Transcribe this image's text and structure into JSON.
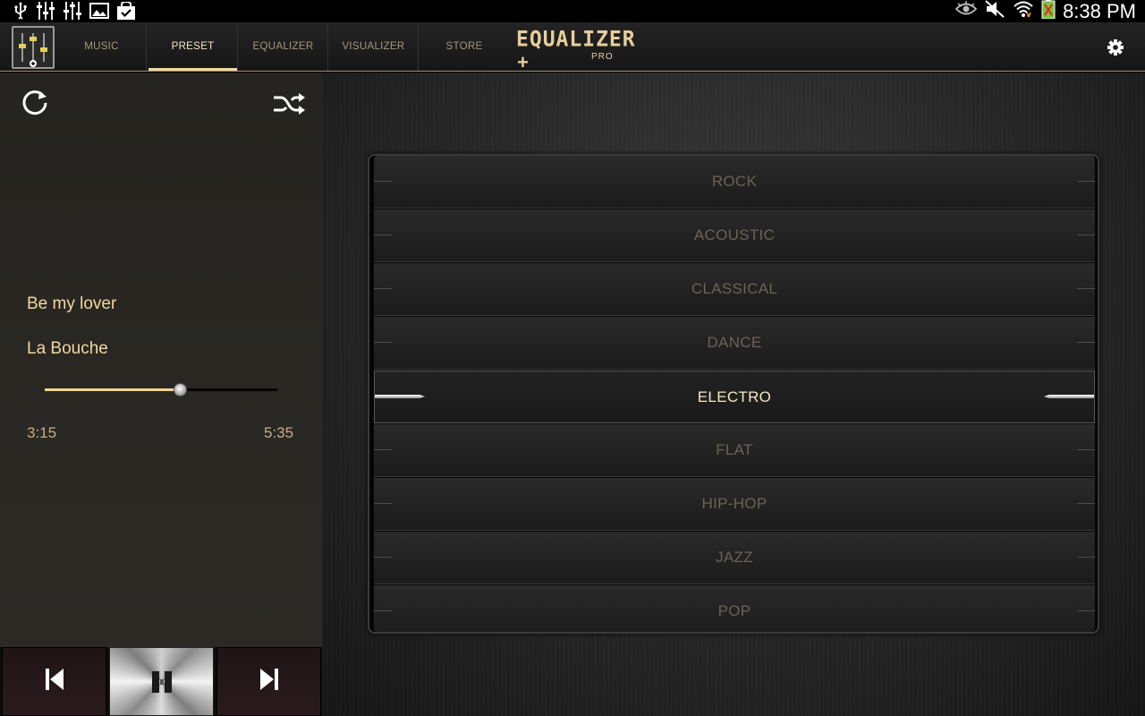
{
  "status_bar": {
    "time": "8:38 PM",
    "left_icons": [
      "usb-icon",
      "equalizer-icon",
      "equalizer-icon",
      "image-icon",
      "shopping-bag-icon"
    ],
    "right_icons": [
      "eye-icon",
      "mute-icon",
      "wifi-icon",
      "battery-icon"
    ]
  },
  "header": {
    "app_icon": "app-mixer-icon",
    "tabs": [
      {
        "label": "MUSIC",
        "active": false
      },
      {
        "label": "PRESET",
        "active": true
      },
      {
        "label": "EQUALIZER",
        "active": false
      },
      {
        "label": "VISUALIZER",
        "active": false
      },
      {
        "label": "STORE",
        "active": false
      }
    ],
    "logo_main": "EQUALIZER",
    "logo_plus": "+",
    "logo_sub": "PRO",
    "settings_icon": "gear-icon"
  },
  "player": {
    "repeat_icon": "repeat-icon",
    "shuffle_icon": "shuffle-icon",
    "song_title": "Be my lover",
    "artist": "La Bouche",
    "current_time": "3:15",
    "total_time": "5:35",
    "progress": 0.58
  },
  "transport": {
    "prev_icon": "skip-previous-icon",
    "play_pause_icon": "pause-icon",
    "next_icon": "skip-next-icon"
  },
  "presets": {
    "items": [
      "ROCK",
      "ACOUSTIC",
      "CLASSICAL",
      "DANCE",
      "ELECTRO",
      "FLAT",
      "HIP-HOP",
      "JAZZ",
      "POP"
    ],
    "selected": "ELECTRO"
  },
  "colors": {
    "accent": "#f0d9a0",
    "text_dim": "#6a6457",
    "tab_inactive": "#a4987e"
  }
}
